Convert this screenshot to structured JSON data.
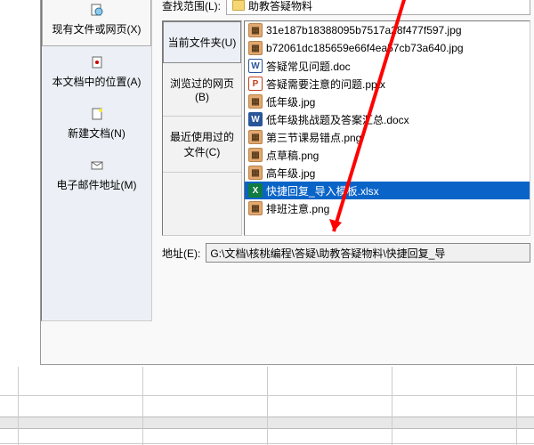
{
  "leftPanel": {
    "items": [
      {
        "label": "现有文件或网页(X)"
      },
      {
        "label": "本文档中的位置(A)"
      },
      {
        "label": "新建文档(N)"
      },
      {
        "label": "电子邮件地址(M)"
      }
    ]
  },
  "search": {
    "label": "查找范围(L):",
    "folder": "助教答疑物料"
  },
  "tabs": {
    "current": "当前文件夹(U)",
    "browsed": "浏览过的网页(B)",
    "recent": "最近使用过的文件(C)"
  },
  "files": [
    {
      "name": "31e187b18388095b7517a28f477f597.jpg",
      "type": "jpg"
    },
    {
      "name": "b72061dc185659e66f4ea57cb73a640.jpg",
      "type": "jpg"
    },
    {
      "name": "答疑常见问题.doc",
      "type": "doc"
    },
    {
      "name": "答疑需要注意的问题.pptx",
      "type": "ppt"
    },
    {
      "name": "低年级.jpg",
      "type": "jpg"
    },
    {
      "name": "低年级挑战题及答案汇总.docx",
      "type": "docx"
    },
    {
      "name": "第三节课易错点.png",
      "type": "png"
    },
    {
      "name": "点草稿.png",
      "type": "png"
    },
    {
      "name": "高年级.jpg",
      "type": "jpg"
    },
    {
      "name": "快捷回复_导入模板.xlsx",
      "type": "xlsx",
      "selected": true
    },
    {
      "name": "排班注意.png",
      "type": "png"
    }
  ],
  "address": {
    "label": "地址(E):",
    "value": "G:\\文档\\核桃编程\\答疑\\助教答疑物料\\快捷回复_导"
  },
  "icons": {
    "jpg": "▦",
    "doc": "W",
    "ppt": "P",
    "docx": "W",
    "png": "▦",
    "xlsx": "X"
  }
}
